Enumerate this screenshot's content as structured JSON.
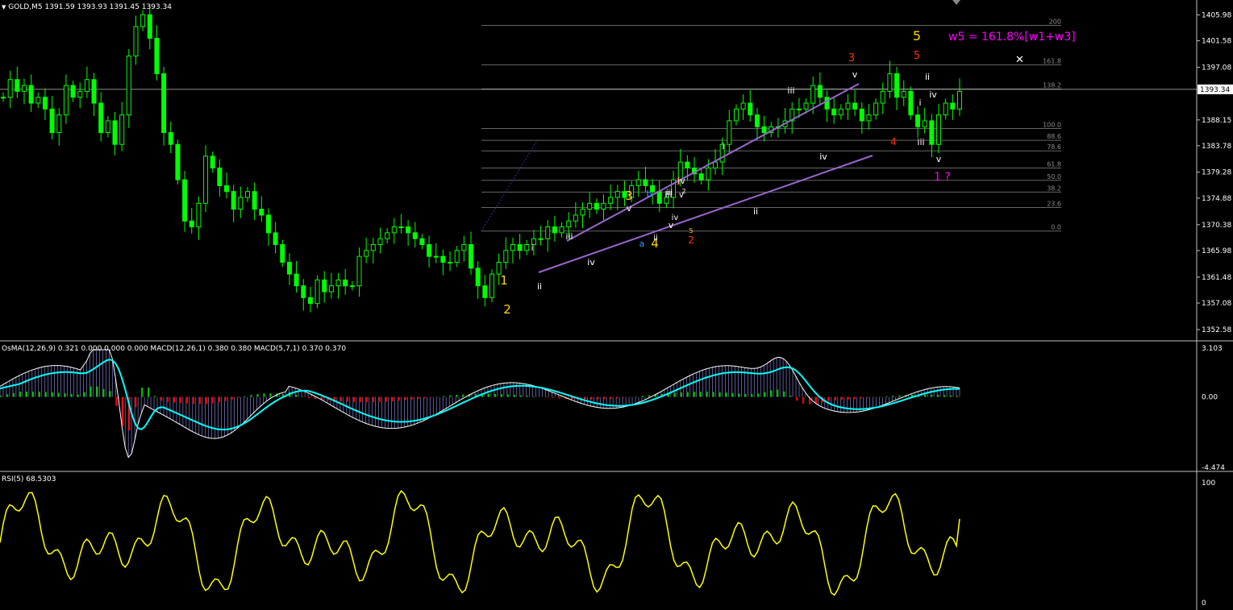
{
  "window": {
    "symbol": "GOLD,M5",
    "ohlc": "1391.59 1393.93 1391.45 1393.34"
  },
  "colors": {
    "background": "#000000",
    "candle": "#00ff00",
    "separator": "#c0c0c0",
    "axis_text": "#ffffff",
    "wedge": "#9966cc",
    "fib": "#666666",
    "price_line": "#c0c0c0",
    "osma_pos_strong": "#00c000",
    "osma_pos_weak": "#006400",
    "osma_neg": "#ff0000",
    "macd_signal": "#00ffff",
    "macd_hist": "#9999ff",
    "macd_fast": "#ffffff",
    "rsi": "#ffff00",
    "wave_yellow": "#ffd700",
    "wave_red": "#ff3300",
    "wave_white": "#ffffff",
    "wave_blue": "#3399ff",
    "wave_magenta": "#ff00ff"
  },
  "price_axis": {
    "ticks": [
      "1405.98",
      "1401.58",
      "1397.08",
      "1393.34",
      "1388.15",
      "1383.78",
      "1379.28",
      "1374.88",
      "1370.38",
      "1365.98",
      "1361.48",
      "1357.08",
      "1352.58"
    ],
    "current": "1393.34"
  },
  "fib_levels": [
    {
      "label": "200",
      "price": 1404.2
    },
    {
      "label": "161.8",
      "price": 1397.5
    },
    {
      "label": "138.2",
      "price": 1393.4
    },
    {
      "label": "100.0",
      "price": 1386.7
    },
    {
      "label": "88.6",
      "price": 1384.7
    },
    {
      "label": "78.6",
      "price": 1382.9
    },
    {
      "label": "61.8",
      "price": 1380.0
    },
    {
      "label": "50.0",
      "price": 1377.9
    },
    {
      "label": "38.2",
      "price": 1375.9
    },
    {
      "label": "23.6",
      "price": 1373.3
    },
    {
      "label": "0.0",
      "price": 1369.3
    }
  ],
  "osma": {
    "header": "OsMA(12,26,9) 0.321 0.000 0.000 0.000  MACD(12,26,1) 0.380 0.380  MACD(5,7,1) 0.370 0.370",
    "ticks": [
      "3.103",
      "0.00",
      "-4.474"
    ]
  },
  "rsi": {
    "header": "RSI(5) 68.5303",
    "ticks": [
      "100",
      "0"
    ]
  },
  "annotations": {
    "target_text": "w5 = 161.8%[w1+w3]",
    "one_question": "1 ?",
    "marker": "✕",
    "waves": [
      {
        "t": "1",
        "c": "wave_yellow",
        "s": 15
      },
      {
        "t": "2",
        "c": "wave_yellow",
        "s": 15
      },
      {
        "t": "3",
        "c": "wave_yellow",
        "s": 15
      },
      {
        "t": "4",
        "c": "wave_yellow",
        "s": 15
      },
      {
        "t": "5",
        "c": "wave_yellow",
        "s": 16
      },
      {
        "t": "3",
        "c": "wave_red",
        "s": 13
      },
      {
        "t": "5",
        "c": "wave_red",
        "s": 13
      },
      {
        "t": "4",
        "c": "wave_red",
        "s": 12
      },
      {
        "t": "1",
        "c": "wave_red",
        "s": 11
      },
      {
        "t": "2",
        "c": "wave_red",
        "s": 12
      },
      {
        "t": "i",
        "c": "wave_white",
        "s": 11
      },
      {
        "t": "ii",
        "c": "wave_white",
        "s": 11
      },
      {
        "t": "iii",
        "c": "wave_white",
        "s": 11
      },
      {
        "t": "iv",
        "c": "wave_white",
        "s": 11
      },
      {
        "t": "v",
        "c": "wave_white",
        "s": 11
      },
      {
        "t": "i",
        "c": "wave_white",
        "s": 11
      },
      {
        "t": "ii",
        "c": "wave_white",
        "s": 11
      },
      {
        "t": "iii",
        "c": "wave_white",
        "s": 11
      },
      {
        "t": "iv",
        "c": "wave_white",
        "s": 11
      },
      {
        "t": "v",
        "c": "wave_white",
        "s": 11
      },
      {
        "t": "iii",
        "c": "wave_white",
        "s": 11
      },
      {
        "t": "iv",
        "c": "wave_white",
        "s": 11
      },
      {
        "t": "v",
        "c": "wave_white",
        "s": 11
      },
      {
        "t": "i",
        "c": "wave_white",
        "s": 11
      },
      {
        "t": "ii",
        "c": "wave_white",
        "s": 11
      },
      {
        "t": "iii",
        "c": "wave_white",
        "s": 11
      },
      {
        "t": "iv",
        "c": "wave_white",
        "s": 11
      },
      {
        "t": "v",
        "c": "wave_white",
        "s": 11
      },
      {
        "t": "a",
        "c": "wave_blue",
        "s": 11
      },
      {
        "t": "b",
        "c": "wave_blue",
        "s": 11
      },
      {
        "t": "iii",
        "c": "wave_white",
        "s": 10
      },
      {
        "t": "iv",
        "c": "wave_white",
        "s": 10
      },
      {
        "t": "ii",
        "c": "wave_white",
        "s": 10
      },
      {
        "t": "v",
        "c": "wave_white",
        "s": 10
      },
      {
        "t": "2",
        "c": "wave_white",
        "s": 8
      },
      {
        "t": "5",
        "c": "wave_yellow",
        "s": 8
      }
    ]
  },
  "chart_data": {
    "type": "candlestick",
    "symbol": "GOLD",
    "timeframe": "M5",
    "ylim": [
      1350.8,
      1408.5
    ],
    "price_series": [
      1392,
      1395,
      1393,
      1394,
      1391,
      1392,
      1390,
      1386,
      1389,
      1394,
      1392,
      1393,
      1395,
      1391,
      1386,
      1388,
      1384,
      1389,
      1399,
      1404,
      1406,
      1402,
      1396,
      1386,
      1384,
      1378,
      1371,
      1370,
      1374,
      1382,
      1380,
      1377,
      1376,
      1373,
      1375,
      1376,
      1373,
      1372,
      1369,
      1367,
      1364,
      1362,
      1360,
      1358,
      1357,
      1361,
      1359,
      1360,
      1361,
      1360,
      1360,
      1365,
      1366,
      1367,
      1368,
      1369,
      1370,
      1370,
      1369,
      1368,
      1367,
      1365,
      1365,
      1364,
      1364,
      1366,
      1367,
      1363,
      1360,
      1358,
      1362,
      1364,
      1366,
      1367,
      1366,
      1367,
      1368,
      1368,
      1370,
      1369,
      1370,
      1371,
      1372,
      1373,
      1374,
      1373,
      1374,
      1375,
      1376,
      1375,
      1377,
      1378,
      1377,
      1376,
      1374,
      1375,
      1378,
      1381,
      1380,
      1379,
      1378,
      1380,
      1381,
      1384,
      1388,
      1390,
      1391,
      1389,
      1387,
      1386,
      1387,
      1387,
      1388,
      1390,
      1390,
      1391,
      1394,
      1392,
      1390,
      1389,
      1390,
      1391,
      1390,
      1388,
      1389,
      1391,
      1393,
      1396,
      1392,
      1393,
      1389,
      1387,
      1388,
      1384,
      1389,
      1391,
      1390,
      1393
    ],
    "osma_range": [
      -4.474,
      3.103
    ],
    "rsi_range": [
      0,
      100
    ],
    "rsi_last": 68.5303
  }
}
